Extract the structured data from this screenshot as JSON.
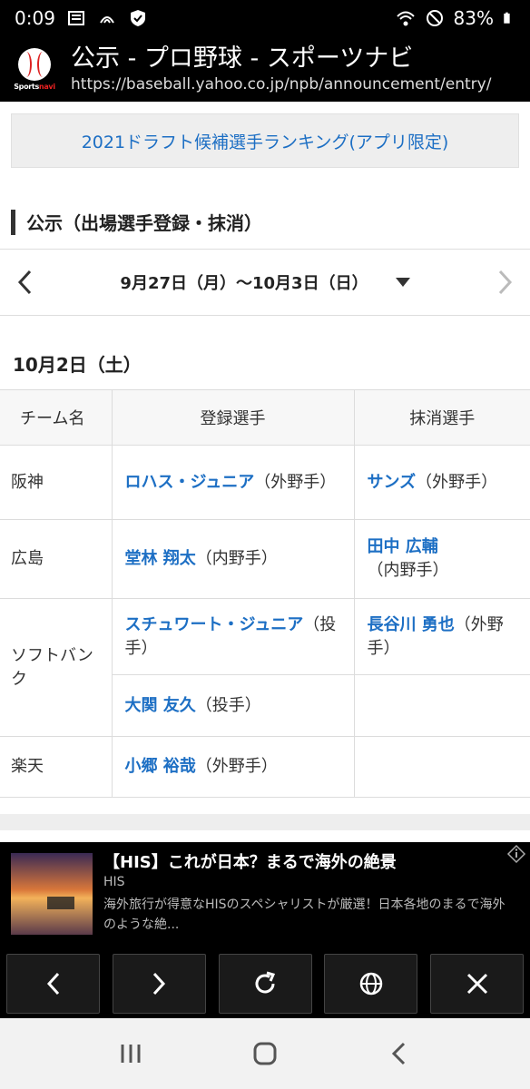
{
  "status_bar": {
    "time": "0:09",
    "battery": "83%",
    "icons": [
      "newspaper-icon",
      "nfc-icon",
      "shield-check-icon",
      "wifi-icon",
      "block-icon",
      "battery-icon"
    ]
  },
  "browser": {
    "title": "公示 - プロ野球 - スポーツナビ",
    "url": "https://baseball.yahoo.co.jp/npb/announcement/entry/",
    "logo_wordmark_a": "Sports",
    "logo_wordmark_b": "navi"
  },
  "promo": {
    "label": "2021ドラフト候補選手ランキング(アプリ限定)"
  },
  "section": {
    "heading": "公示（出場選手登録・抹消）"
  },
  "week_nav": {
    "range": "9月27日（月）〜10月3日（日）"
  },
  "day": {
    "date": "10月2日（土）",
    "columns": [
      "チーム名",
      "登録選手",
      "抹消選手"
    ],
    "rows": [
      {
        "team": "阪神",
        "registered": [
          {
            "name": "ロハス・ジュニア",
            "position": "（外野手）"
          }
        ],
        "removed": [
          {
            "name": "サンズ",
            "position": "（外野手）"
          }
        ]
      },
      {
        "team": "広島",
        "registered": [
          {
            "name": "堂林 翔太",
            "position": "（内野手）"
          }
        ],
        "removed": [
          {
            "name": "田中 広輔",
            "position": "（内野手）"
          }
        ]
      },
      {
        "team": "ソフトバンク",
        "registered": [
          {
            "name": "スチュワート・ジュニア",
            "position": "（投手）"
          },
          {
            "name": "大関 友久",
            "position": "（投手）"
          }
        ],
        "removed": [
          {
            "name": "長谷川 勇也",
            "position": "（外野手）"
          }
        ]
      },
      {
        "team": "楽天",
        "registered": [
          {
            "name": "小郷 裕哉",
            "position": "（外野手）"
          }
        ],
        "removed": []
      }
    ]
  },
  "ad": {
    "title": "【HIS】これが日本？まるで海外の絶景",
    "brand": "HIS",
    "description": "海外旅行が得意なHISのスペシャリストが厳選！日本各地のまるで海外のような絶..."
  },
  "toolbar": {
    "buttons": [
      "back-icon",
      "forward-icon",
      "reload-icon",
      "globe-icon",
      "close-icon"
    ]
  },
  "nav_bar": {
    "buttons": [
      "recents-icon",
      "home-icon",
      "back-icon"
    ]
  }
}
